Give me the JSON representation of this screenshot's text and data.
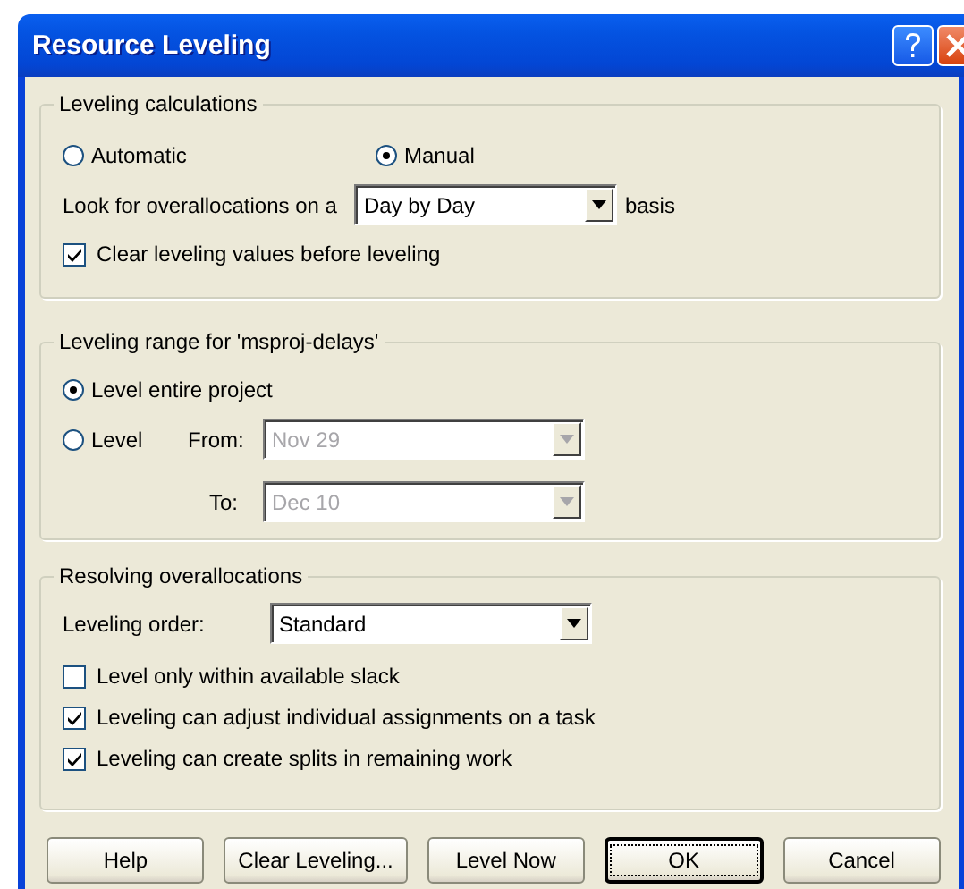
{
  "window": {
    "title": "Resource Leveling"
  },
  "calculations": {
    "title": "Leveling calculations",
    "modes": [
      {
        "label": "Automatic",
        "selected": false
      },
      {
        "label": "Manual",
        "selected": true
      }
    ],
    "look_label": "Look for overallocations on a",
    "basis": {
      "value": "Day by Day",
      "disabled": false
    },
    "basis_suffix": "basis",
    "clear_values": {
      "label": "Clear leveling values before leveling",
      "checked": true
    }
  },
  "range": {
    "title": "Leveling range for 'msproj-delays'",
    "options": [
      {
        "label": "Level entire project",
        "selected": true
      },
      {
        "label": "Level",
        "selected": false
      }
    ],
    "from": {
      "label": "From:",
      "value": "Nov 29",
      "disabled": true
    },
    "to": {
      "label": "To:",
      "value": "Dec 10",
      "disabled": true
    }
  },
  "resolving": {
    "title": "Resolving overallocations",
    "order_label": "Leveling order:",
    "order": {
      "value": "Standard",
      "disabled": false
    },
    "options": [
      {
        "label": "Level only within available slack",
        "checked": false
      },
      {
        "label": "Leveling can adjust individual assignments on a task",
        "checked": true
      },
      {
        "label": "Leveling can create splits in remaining work",
        "checked": true
      }
    ]
  },
  "buttons": [
    {
      "label": "Help",
      "default": false
    },
    {
      "label": "Clear Leveling...",
      "default": false
    },
    {
      "label": "Level Now",
      "default": false
    },
    {
      "label": "OK",
      "default": true
    },
    {
      "label": "Cancel",
      "default": false
    }
  ]
}
